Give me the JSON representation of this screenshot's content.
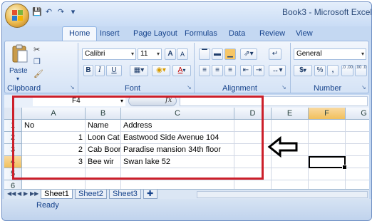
{
  "window": {
    "title": "Book3 - Microsoft Excel"
  },
  "quick_access": {
    "icons": [
      "save-icon",
      "undo-icon",
      "redo-icon",
      "customize-icon"
    ]
  },
  "ribbon": {
    "tabs": [
      "Home",
      "Insert",
      "Page Layout",
      "Formulas",
      "Data",
      "Review",
      "View"
    ],
    "active_tab": "Home",
    "clipboard": {
      "label": "Clipboard",
      "paste_label": "Paste"
    },
    "font": {
      "label": "Font",
      "font_name": "Calibri",
      "font_size": "11",
      "bold": "B",
      "italic": "I",
      "underline": "U",
      "grow": "A",
      "shrink": "A"
    },
    "alignment": {
      "label": "Alignment"
    },
    "number": {
      "label": "Number",
      "format": "General",
      "currency": "$",
      "percent": "%",
      "comma": ",",
      "inc_decimal": ".0 .00",
      "dec_decimal": ".00 .0"
    }
  },
  "formula_bar": {
    "name_box": "F4",
    "fx": "fx",
    "formula": ""
  },
  "sheet": {
    "columns": [
      "A",
      "B",
      "C",
      "D",
      "E",
      "F",
      "G"
    ],
    "selected_column": "F",
    "rows": [
      "1",
      "2",
      "3",
      "4",
      "5",
      "6"
    ],
    "selected_row": "4",
    "cells": {
      "A1": "No",
      "B1": "Name",
      "C1": "Address",
      "A2": "1",
      "B2": "Loon Cat",
      "C2": "Eastwood Side Avenue 104",
      "A3": "2",
      "B3": "Cab Boor",
      "C3": "Paradise mansion 34th floor",
      "A4": "3",
      "B4": "Bee wir",
      "C4": "Swan lake 52"
    },
    "active_cell": "F4"
  },
  "sheet_tabs": {
    "tabs": [
      "Sheet1",
      "Sheet2",
      "Sheet3"
    ],
    "active": "Sheet1"
  },
  "status": {
    "text": "Ready"
  },
  "colors": {
    "annotation_red": "#cc1f2a",
    "ribbon_blue": "#c4d8f2",
    "selected_header": "#f1c05c"
  }
}
